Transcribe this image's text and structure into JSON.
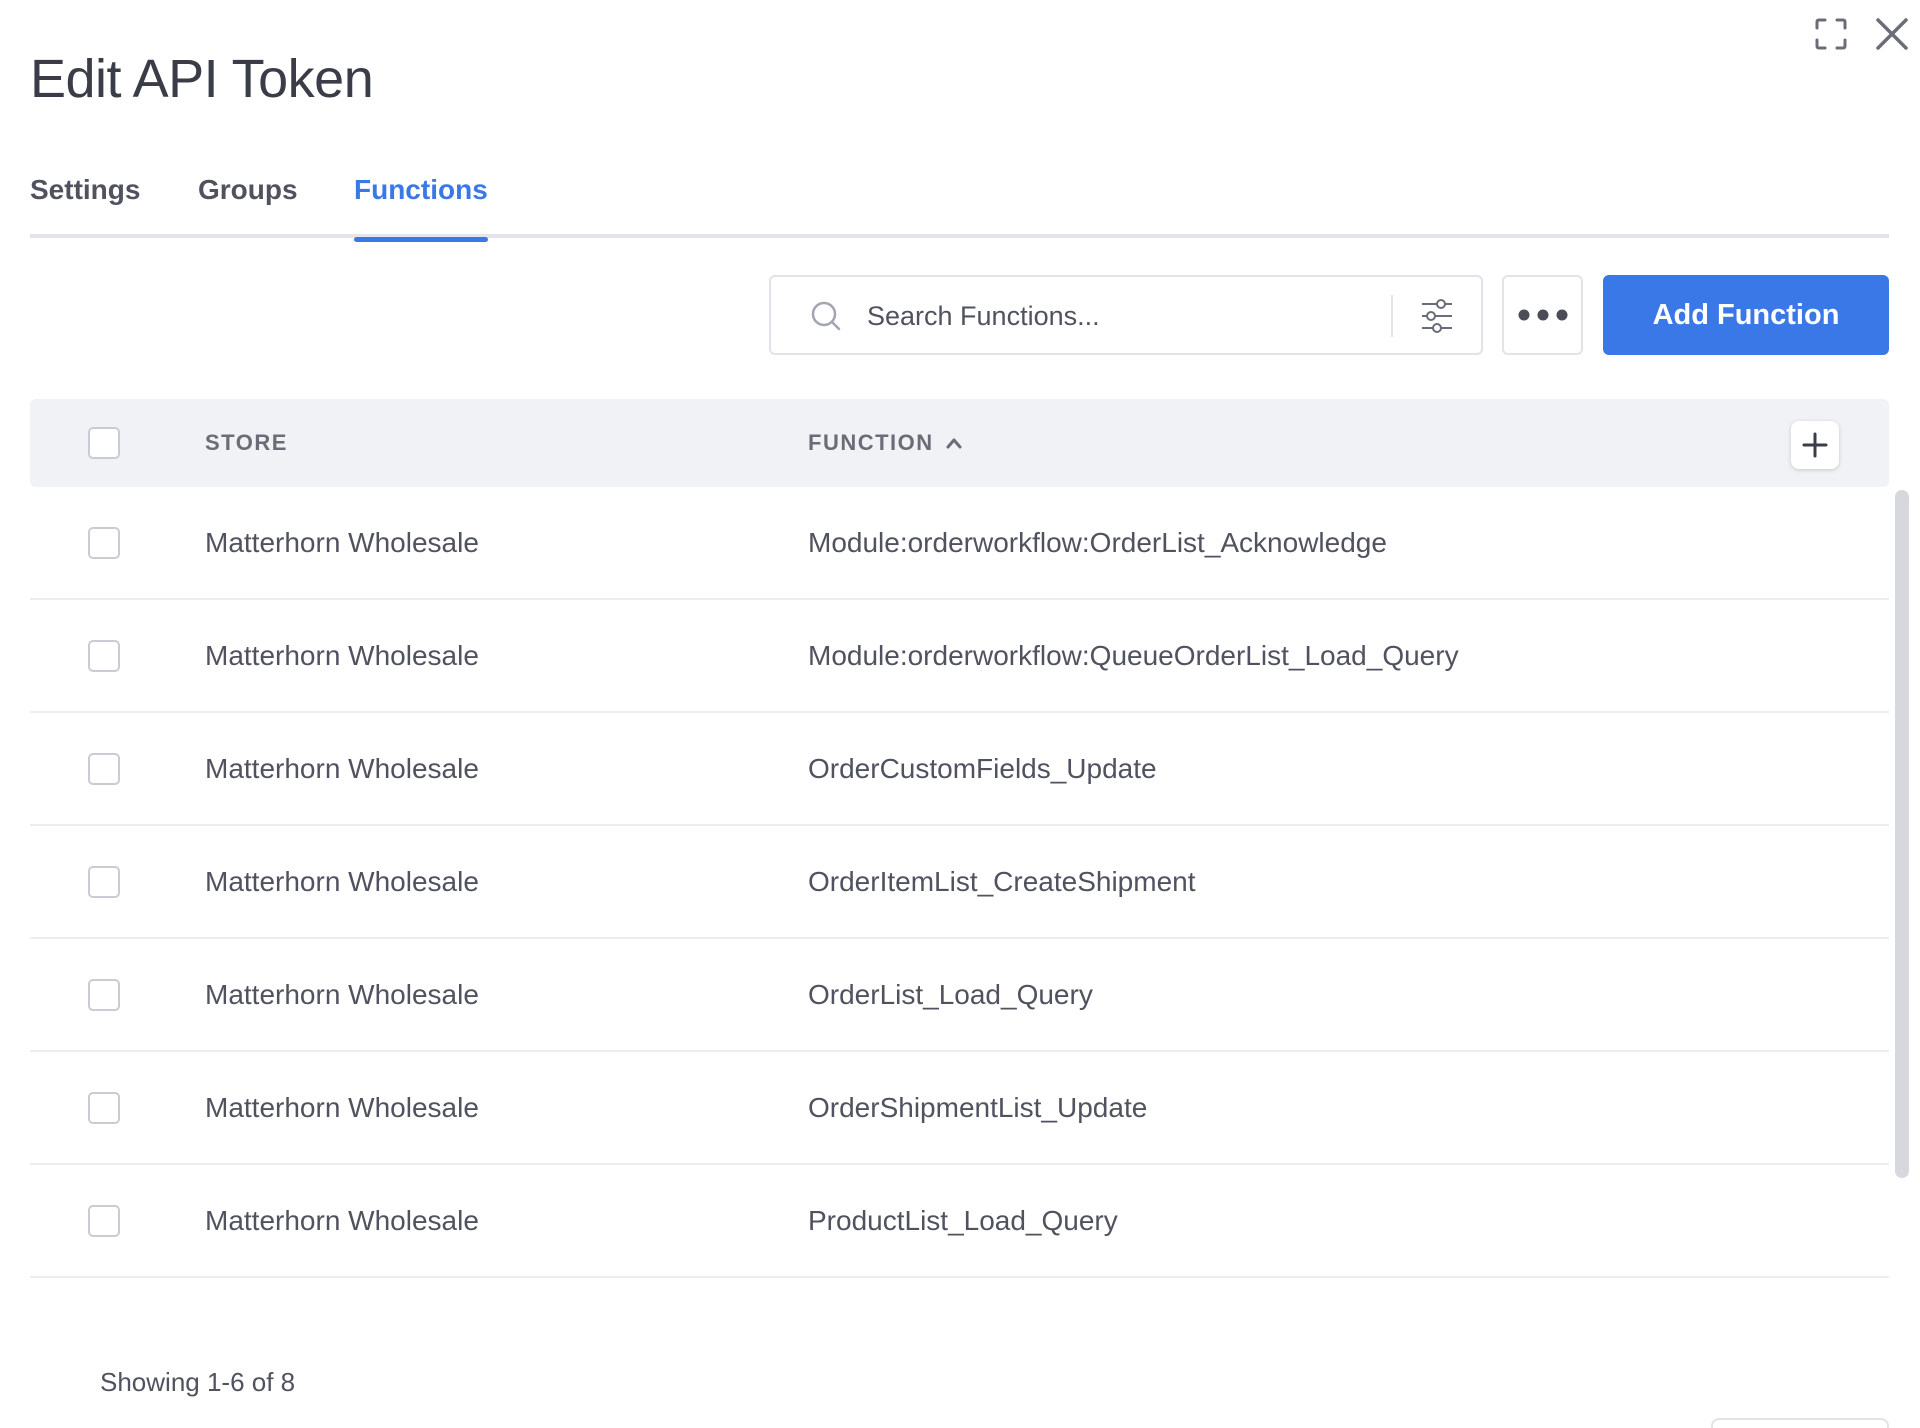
{
  "dialog": {
    "title": "Edit API Token",
    "expand_icon": "expand-icon",
    "close_icon": "close-icon"
  },
  "tabs": [
    {
      "label": "Settings",
      "active": false
    },
    {
      "label": "Groups",
      "active": false
    },
    {
      "label": "Functions",
      "active": true
    }
  ],
  "toolbar": {
    "search_placeholder": "Search Functions...",
    "filter_icon": "sliders-icon",
    "more_icon": "ellipsis-icon",
    "add_label": "Add Function"
  },
  "table": {
    "columns": {
      "store": "STORE",
      "function": "FUNCTION"
    },
    "sort": {
      "column": "function",
      "direction": "ascending"
    },
    "rows": [
      {
        "store": "Matterhorn Wholesale",
        "function": "Module:orderworkflow:OrderList_Acknowledge"
      },
      {
        "store": "Matterhorn Wholesale",
        "function": "Module:orderworkflow:QueueOrderList_Load_Query"
      },
      {
        "store": "Matterhorn Wholesale",
        "function": "OrderCustomFields_Update"
      },
      {
        "store": "Matterhorn Wholesale",
        "function": "OrderItemList_CreateShipment"
      },
      {
        "store": "Matterhorn Wholesale",
        "function": "OrderList_Load_Query"
      },
      {
        "store": "Matterhorn Wholesale",
        "function": "OrderShipmentList_Update"
      },
      {
        "store": "Matterhorn Wholesale",
        "function": "ProductList_Load_Query"
      }
    ]
  },
  "pagination": {
    "showing": "Showing 1-6 of 8"
  },
  "colors": {
    "accent": "#3b78e7",
    "text": "#50535f",
    "header_bg": "#f1f2f6"
  }
}
